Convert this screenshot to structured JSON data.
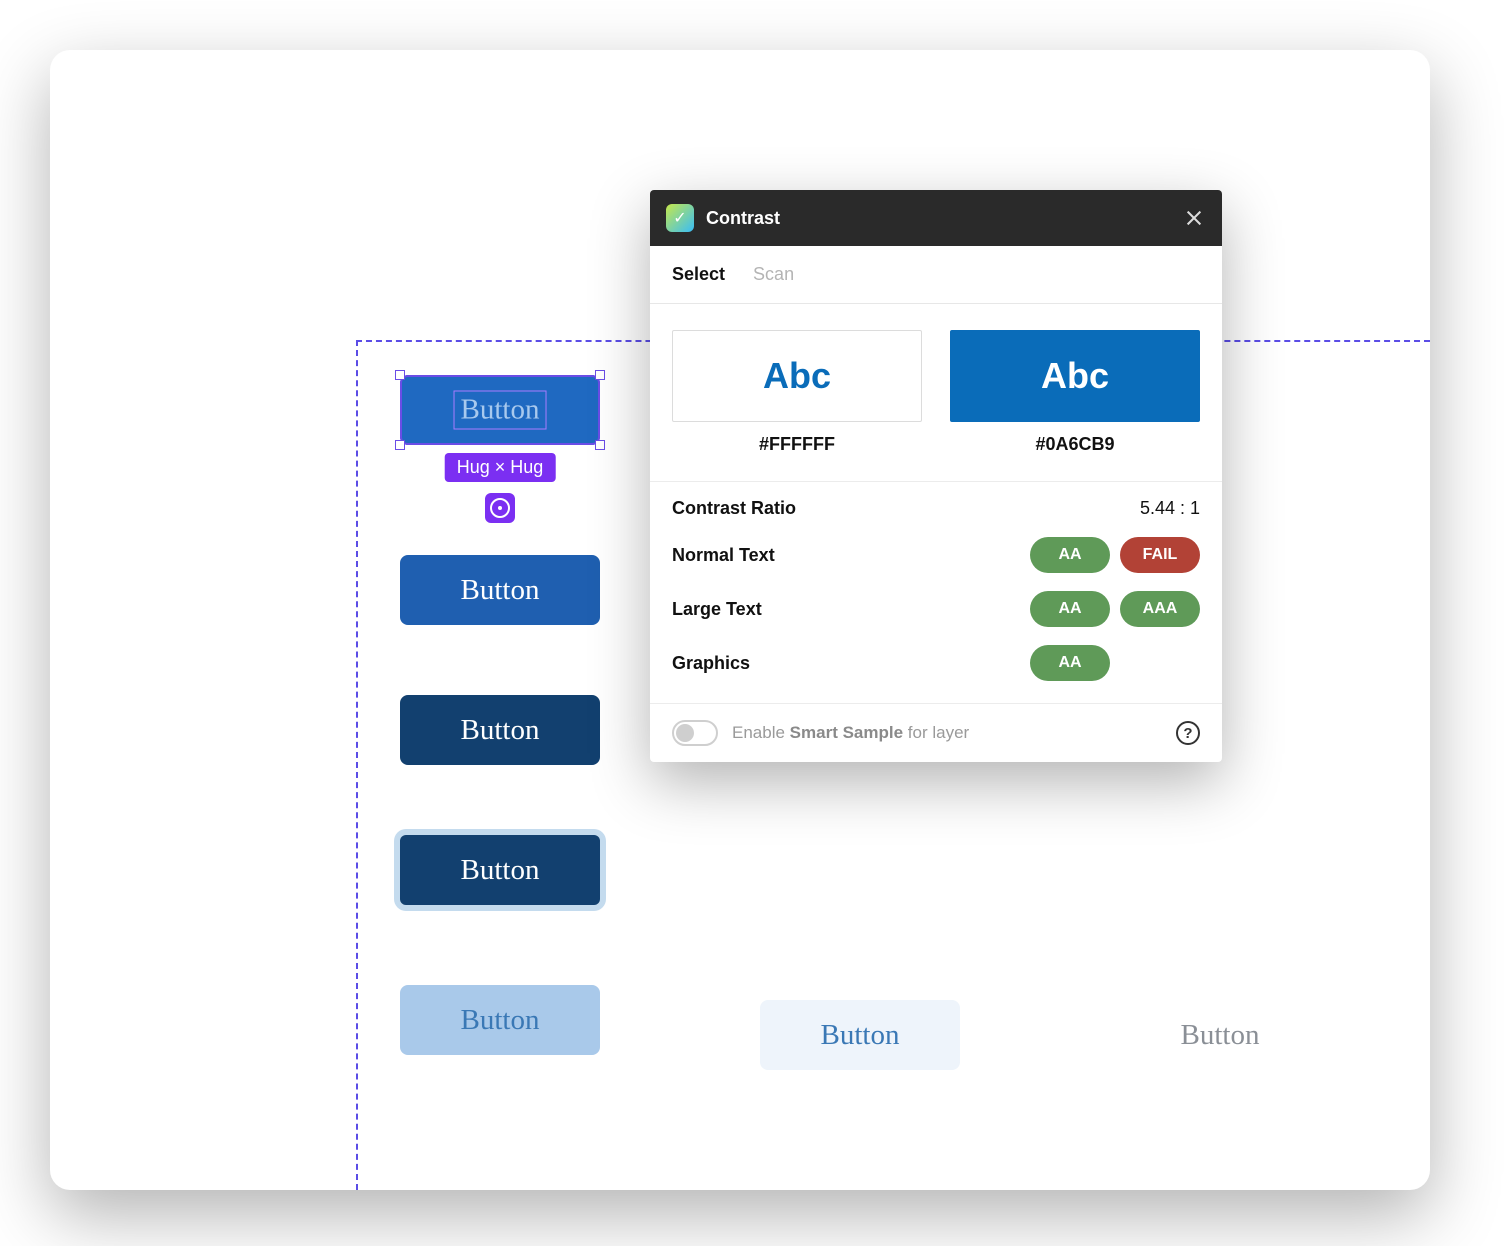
{
  "canvas": {
    "selected_button_label": "Button",
    "dimensions_label": "Hug × Hug",
    "buttons": [
      "Button",
      "Button",
      "Button",
      "Button",
      "Button"
    ],
    "bottom_row": [
      "Button",
      "Button"
    ]
  },
  "panel": {
    "title": "Contrast",
    "tabs": {
      "select": "Select",
      "scan": "Scan",
      "active": "select"
    },
    "sample_text": "Abc",
    "foreground_hex": "#FFFFFF",
    "background_hex": "#0A6CB9",
    "ratio_label": "Contrast Ratio",
    "ratio_value": "5.44 : 1",
    "rows": {
      "normal": {
        "label": "Normal Text",
        "aa": "AA",
        "aaa": "FAIL",
        "aa_pass": true,
        "aaa_pass": false
      },
      "large": {
        "label": "Large Text",
        "aa": "AA",
        "aaa": "AAA",
        "aa_pass": true,
        "aaa_pass": true
      },
      "graphics": {
        "label": "Graphics",
        "aa": "AA",
        "aa_pass": true
      }
    },
    "footer": {
      "enable": "Enable",
      "smart_sample": "Smart Sample",
      "for_layer": "for layer"
    }
  }
}
